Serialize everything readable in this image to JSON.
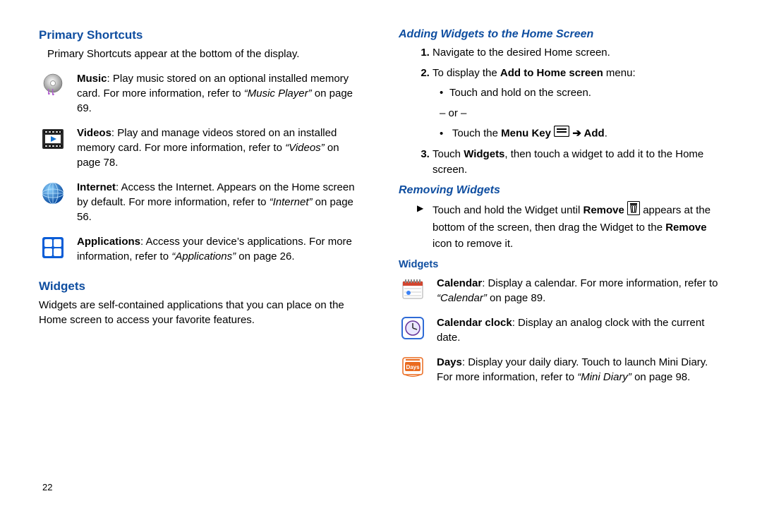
{
  "page_number": "22",
  "left": {
    "heading_primary": "Primary Shortcuts",
    "intro": "Primary Shortcuts appear at the bottom of the display.",
    "items": [
      {
        "title": "Music",
        "body": ": Play music stored on an optional installed memory card. For more information, refer to ",
        "ref": "“Music Player”",
        "tail": "  on page 69."
      },
      {
        "title": "Videos",
        "body": ": Play and manage videos stored on an installed memory card. For more information, refer to ",
        "ref": "“Videos”",
        "tail": "  on page 78."
      },
      {
        "title": "Internet",
        "body": ": Access the Internet. Appears on the Home screen by default. For more information, refer to ",
        "ref": "“Internet”",
        "tail": "  on page 56."
      },
      {
        "title": "Applications",
        "body": ": Access your device’s applications. For more information, refer to ",
        "ref": "“Applications”",
        "tail": "  on page 26."
      }
    ],
    "heading_widgets": "Widgets",
    "widgets_intro": "Widgets are self-contained applications that you can place on the Home screen to access your favorite features."
  },
  "right": {
    "heading_adding": "Adding Widgets to the Home Screen",
    "step1": "Navigate to the desired Home screen.",
    "step2_pre": "To display the ",
    "step2_b": "Add to Home screen",
    "step2_post": " menu:",
    "sub_touchhold": "Touch and hold on the screen.",
    "or_text": "– or –",
    "sub_menukey_pre": "Touch the ",
    "sub_menukey_b1": "Menu Key",
    "sub_menukey_arrow": " ➔ ",
    "sub_menukey_b2": "Add",
    "sub_menukey_post": ".",
    "step3_pre": "Touch ",
    "step3_b": "Widgets",
    "step3_post": ", then touch a widget to add it to the Home screen.",
    "heading_removing": "Removing Widgets",
    "remove_pre": "Touch and hold the Widget until ",
    "remove_b1": "Remove",
    "remove_mid": " appears at the bottom of the screen, then drag the Widget to the ",
    "remove_b2": "Remove",
    "remove_post": " icon to remove it.",
    "heading_widgets": "Widgets",
    "witems": [
      {
        "title": "Calendar",
        "body": ": Display a calendar. For more information, refer to ",
        "ref": "“Calendar”",
        "tail": "  on page 89."
      },
      {
        "title": "Calendar clock",
        "body": ": Display an analog clock with the current date.",
        "ref": "",
        "tail": ""
      },
      {
        "title": "Days",
        "body": ": Display your daily diary. Touch to launch Mini Diary. For more information, refer to ",
        "ref": "“Mini Diary”",
        "tail": "  on page 98."
      }
    ]
  }
}
